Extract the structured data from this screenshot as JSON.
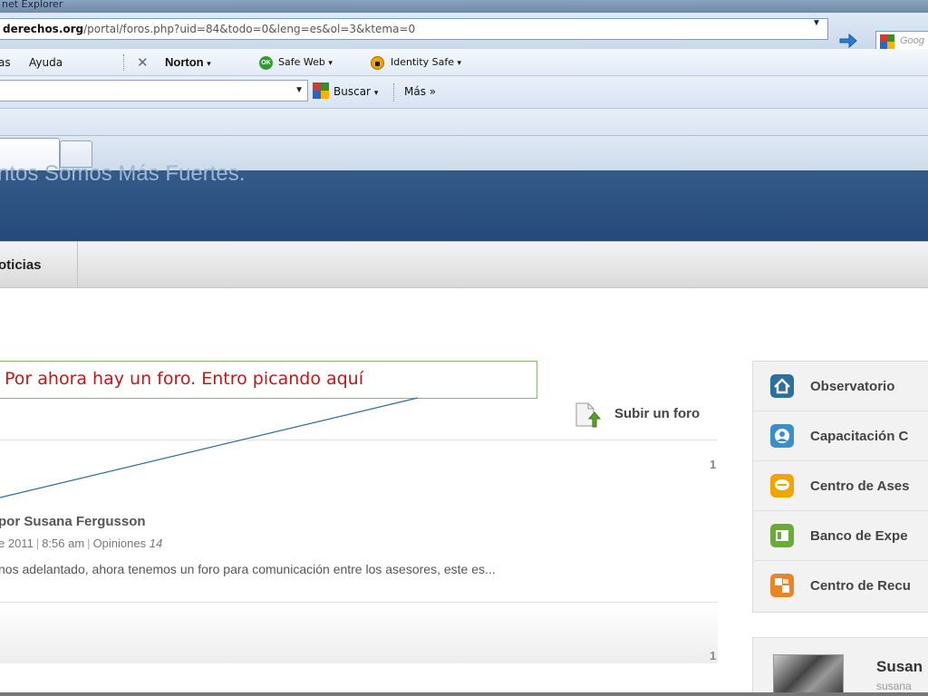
{
  "window": {
    "title": "net Explorer"
  },
  "address_bar": {
    "domain": "derechos.org",
    "path": "/portal/foros.php?uid=84&todo=0&leng=es&ol=3&ktema=0",
    "search_placeholder": "Goog"
  },
  "menu": {
    "items": [
      "as",
      "Ayuda"
    ],
    "norton": "Norton",
    "safe_web": "Safe Web",
    "identity_safe": "Identity Safe",
    "ok_badge": "OK"
  },
  "google_toolbar": {
    "buscar": "Buscar",
    "mas": "Más »"
  },
  "site": {
    "banner_text": "ntos Somos Más Fuertes.",
    "nav_item": "oticias"
  },
  "annotation": {
    "text": "Por ahora hay un foro. Entro picando aquí"
  },
  "forum": {
    "upload_label": "Subir un foro",
    "topics": [
      {
        "count": "1",
        "author": "por Susana Fergusson",
        "date": "e 2011",
        "time": "8:56 am",
        "opinions_label": "Opiniones",
        "opinions": "14",
        "excerpt": "nos adelantado, ahora tenemos un foro para comunicación entre los asesores, este es..."
      },
      {
        "count": "1"
      }
    ]
  },
  "sidebar": {
    "items": [
      {
        "label": "Observatorio",
        "icon": "home-icon",
        "color": "#2e6f9e"
      },
      {
        "label": "Capacitación C",
        "icon": "person-icon",
        "color": "#3a8fc7"
      },
      {
        "label": "Centro de Ases",
        "icon": "chat-icon",
        "color": "#f0a500"
      },
      {
        "label": "Banco de Expe",
        "icon": "book-icon",
        "color": "#6aaa3a"
      },
      {
        "label": "Centro de Recu",
        "icon": "resources-icon",
        "color": "#e8852a"
      }
    ]
  },
  "profile": {
    "name": "Susan",
    "username": "susana"
  }
}
